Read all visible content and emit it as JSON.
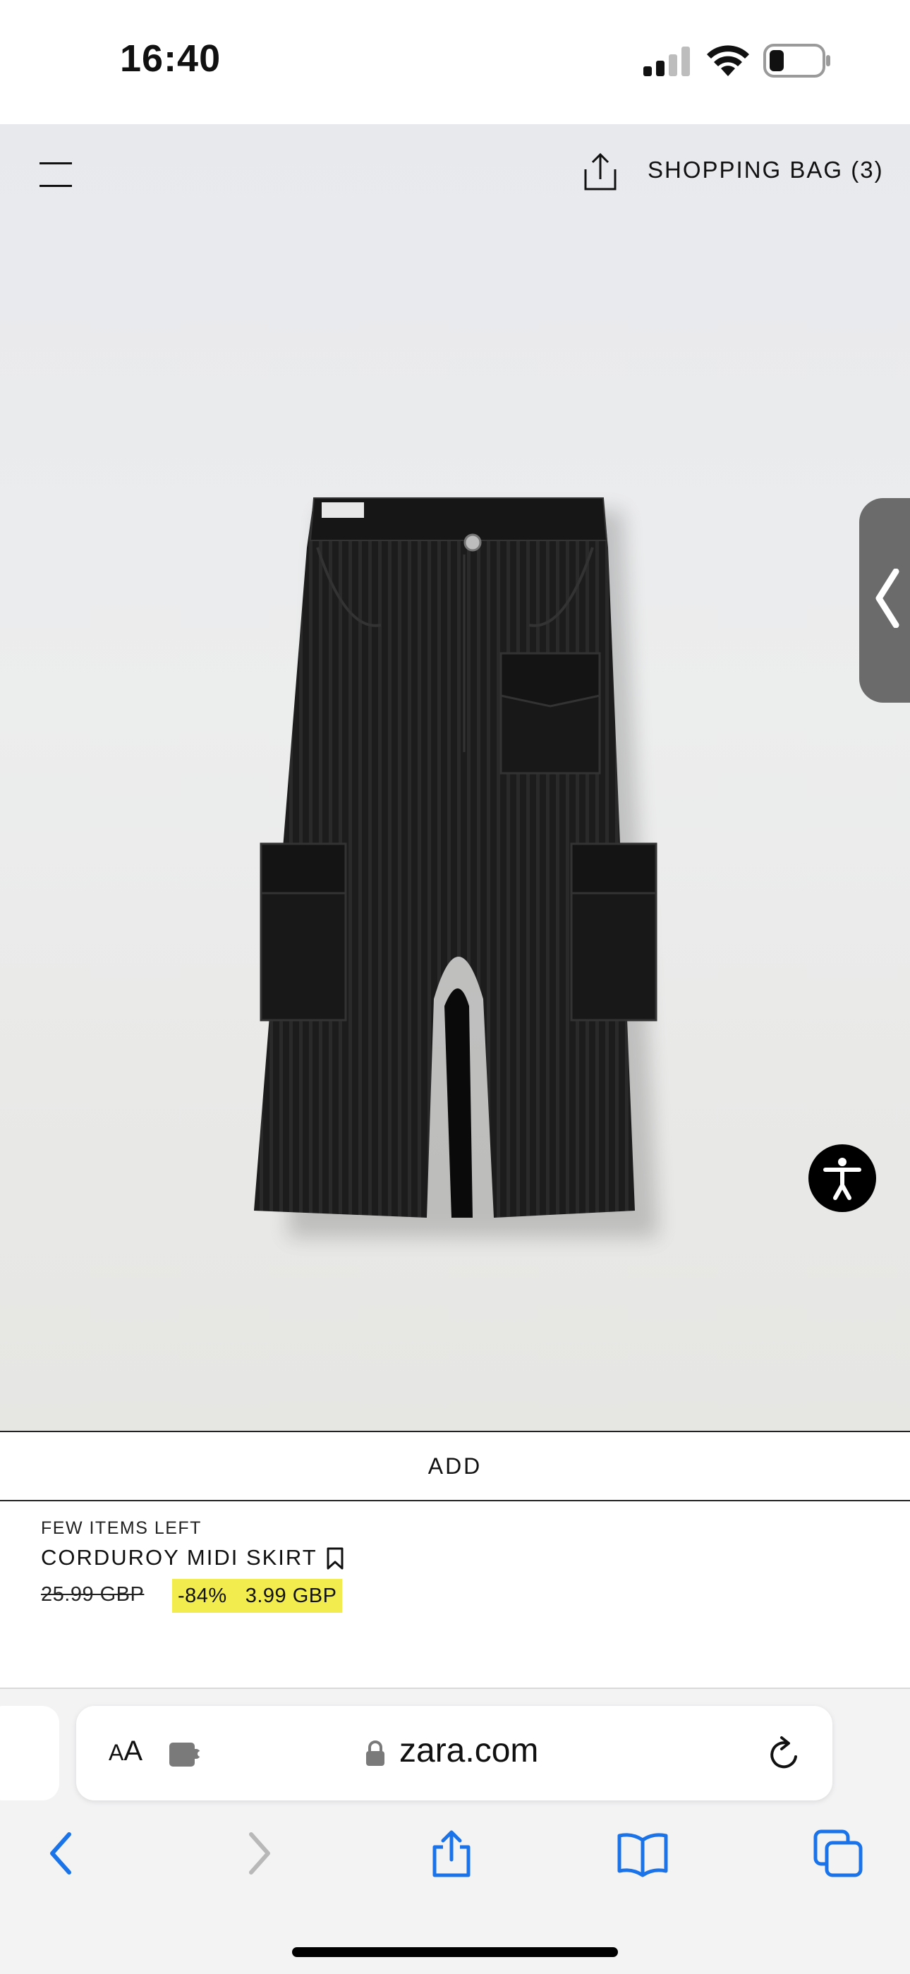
{
  "status_bar": {
    "time": "16:40"
  },
  "header": {
    "shopping_bag_label": "SHOPPING BAG (3)"
  },
  "product": {
    "availability": "FEW ITEMS LEFT",
    "name": "CORDUROY MIDI SKIRT",
    "original_price": "25.99 GBP",
    "discount": "-84%",
    "sale_price": "3.99 GBP",
    "add_label": "ADD"
  },
  "browser": {
    "text_size_label_small": "A",
    "text_size_label_large": "A",
    "domain": "zara.com"
  },
  "icons": {
    "menu": "hamburger-menu-icon",
    "share": "share-icon",
    "side_tab": "chevron-left-icon",
    "accessibility": "accessibility-icon",
    "bookmark": "bookmark-icon",
    "extension": "extension-icon",
    "lock": "lock-icon",
    "reload": "reload-icon",
    "back": "back-icon",
    "forward": "forward-icon",
    "bookmarks": "bookmarks-icon",
    "tabs": "tabs-icon"
  },
  "colors": {
    "sale_highlight": "#f2ec4e",
    "safari_blue": "#1a73e8",
    "hero_background": "#e9eaec"
  }
}
